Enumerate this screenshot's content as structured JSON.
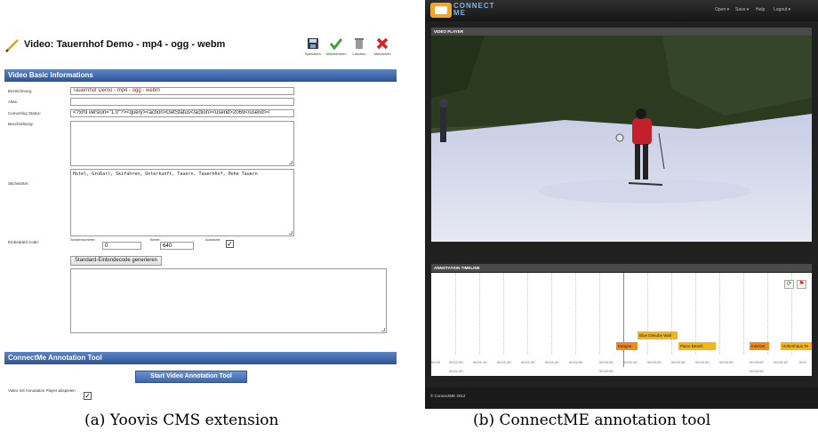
{
  "captions": {
    "a": "(a) Yoovis CMS extension",
    "b": "(b) ConnectME annotation tool"
  },
  "yoovis": {
    "title": "Video: Tauernhof Demo - mp4 - ogg - webm",
    "toolbar": [
      "Speichern",
      "Übernehmen",
      "Löschen",
      "Abbrechen"
    ],
    "section_basic": "Video Basic Informations",
    "labels": {
      "bezeichnung": "Bezeichnung:",
      "alias": "Alias:",
      "converting": "Converting Status:",
      "beschreibung": "Beschreibung:",
      "stichworter": "Stichwörter:",
      "embedded": "Embedded Code:"
    },
    "values": {
      "bezeichnung": "Tauernhof Demo - mp4 - ogg - webm",
      "alias": "",
      "converting": "<?xml version=\"1.0\"?><query><action>GetStatus</action><userid>2069</userid><",
      "beschreibung": "",
      "stichworter": "Hotel, Großarl, Skifahren, Unterkunft, Tauern, Tauernhof, Hohe Tauern"
    },
    "embed": {
      "sendernummer_label": "Sendernummer:",
      "sendernummer": "0",
      "breite_label": "Breite:",
      "breite": "640",
      "autostart_label": "Autostart:",
      "generate_button": "Standard-Einbindecode generieren"
    },
    "section_annotation": "ConnectMe Annotation Tool",
    "start_button": "Start Video Annotation Tool",
    "player_label": "Video mit Annotation Player abspielen"
  },
  "connectme": {
    "logo_top": "CONNECT",
    "logo_bottom": "ME",
    "menu": [
      "Open ▾",
      "Save ▾",
      "Help",
      "Logout ▾"
    ],
    "video_player_header": "VIDEO PLAYER",
    "timeline_header": "ANNOTATION TIMELINE",
    "tags": [
      {
        "label": "Kangce",
        "color": "#f08a1e"
      },
      {
        "label": "Blue Danube Wall",
        "color": "#f3b61a"
      },
      {
        "label": "Piano Beach",
        "color": "#f3b61a"
      },
      {
        "label": "Internet",
        "color": "#f08a1e"
      },
      {
        "label": "Hohenhaus Te",
        "color": "#f3b61a"
      }
    ],
    "ticks": [
      "00:00",
      "00:01:00",
      "00:01:10",
      "00:01:20",
      "00:01:30",
      "00:01:40",
      "00:01:50",
      "00:02:00",
      "00:02:10",
      "00:02:20",
      "00:02:30",
      "00:02:40",
      "00:02:50",
      "00:03:00",
      "00:03:10",
      "00:0"
    ],
    "ticks_second_row": [
      "00:01:00",
      "00:02:00",
      "00:03:00"
    ],
    "footer": "© ConnectME 2012"
  }
}
